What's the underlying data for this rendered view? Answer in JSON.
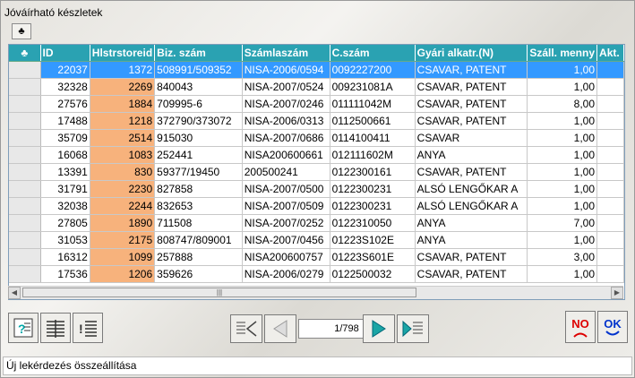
{
  "window": {
    "title": "Jóváírható készletek"
  },
  "toolbar": {
    "club_label": "♣"
  },
  "grid": {
    "columns": [
      "♣",
      "ID",
      "Hlstrstoreid",
      "Biz. szám",
      "Számlaszám",
      "C.szám",
      "Gyári alkatr.(N)",
      "Száll. menny",
      "Akt."
    ],
    "rows": [
      [
        "",
        "22037",
        "1372",
        "508991/509352",
        "NISA-2006/0594",
        "0092227200",
        "CSAVAR, PATENT",
        "1,00",
        ""
      ],
      [
        "",
        "32328",
        "2269",
        "840043",
        "NISA-2007/0524",
        "009231081A",
        "CSAVAR, PATENT",
        "1,00",
        ""
      ],
      [
        "",
        "27576",
        "1884",
        "709995-6",
        "NISA-2007/0246",
        "011111042M",
        "CSAVAR, PATENT",
        "8,00",
        ""
      ],
      [
        "",
        "17488",
        "1218",
        "372790/373072",
        "NISA-2006/0313",
        "0112500661",
        "CSAVAR, PATENT",
        "1,00",
        ""
      ],
      [
        "",
        "35709",
        "2514",
        "915030",
        "NISA-2007/0686",
        "0114100411",
        "CSAVAR",
        "1,00",
        ""
      ],
      [
        "",
        "16068",
        "1083",
        "252441",
        "NISA200600661",
        "012111602M",
        "ANYA",
        "1,00",
        ""
      ],
      [
        "",
        "13391",
        "830",
        "59377/19450",
        "200500241",
        "0122300161",
        "CSAVAR, PATENT",
        "1,00",
        ""
      ],
      [
        "",
        "31791",
        "2230",
        "827858",
        "NISA-2007/0500",
        "0122300231",
        "ALSÓ LENGŐKAR A",
        "1,00",
        ""
      ],
      [
        "",
        "32038",
        "2244",
        "832653",
        "NISA-2007/0509",
        "0122300231",
        "ALSÓ LENGŐKAR A",
        "1,00",
        ""
      ],
      [
        "",
        "27805",
        "1890",
        "711508",
        "NISA-2007/0252",
        "0122310050",
        "ANYA",
        "7,00",
        ""
      ],
      [
        "",
        "31053",
        "2175",
        "808747/809001",
        "NISA-2007/0456",
        "01223S102E",
        "ANYA",
        "1,00",
        ""
      ],
      [
        "",
        "16312",
        "1099",
        "257888",
        "NISA200600757",
        "01223S601E",
        "CSAVAR, PATENT",
        "3,00",
        ""
      ],
      [
        "",
        "17536",
        "1206",
        "359626",
        "NISA-2006/0279",
        "0122500032",
        "CSAVAR, PATENT",
        "1,00",
        ""
      ]
    ]
  },
  "pager": {
    "text": "1/798"
  },
  "buttons": {
    "no_label": "NO",
    "ok_label": "OK"
  },
  "statusbar": {
    "text": "Új lekérdezés összeállítása"
  }
}
